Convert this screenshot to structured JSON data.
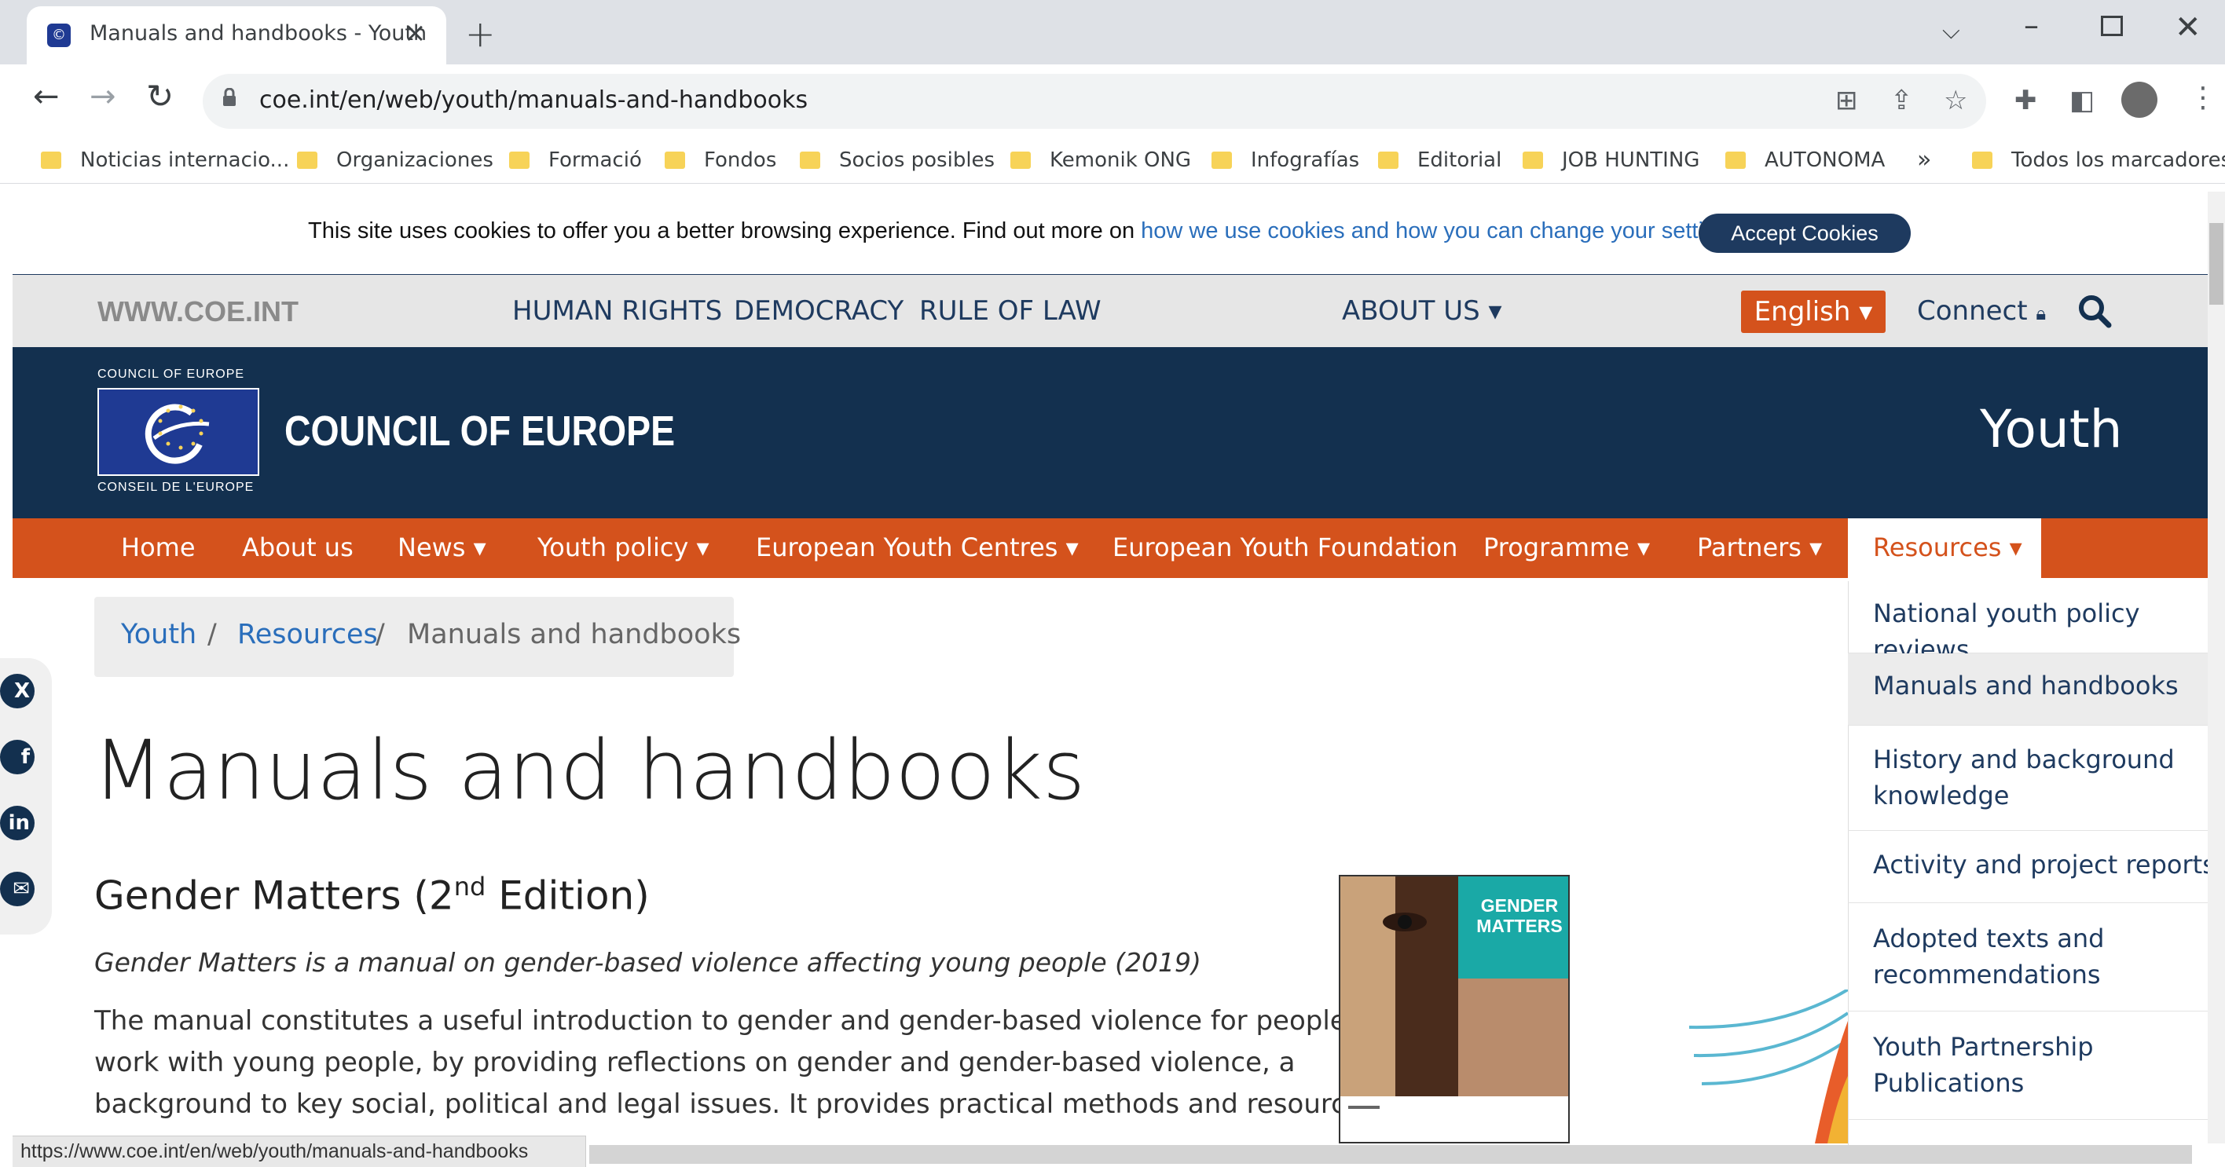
{
  "browser": {
    "tab_title": "Manuals and handbooks - Youth",
    "url": "coe.int/en/web/youth/manuals-and-handbooks",
    "status_url": "https://www.coe.int/en/web/youth/manuals-and-handbooks",
    "bookmarks": [
      "Noticias internacio...",
      "Organizaciones",
      "Formació",
      "Fondos",
      "Socios posibles",
      "Kemonik ONG",
      "Infografías",
      "Editorial",
      "JOB HUNTING",
      "AUTONOMA"
    ],
    "bookmarks_overflow": "»",
    "all_bookmarks": "Todos los marcadores"
  },
  "cookie": {
    "text": "This site uses cookies to offer you a better browsing experience. Find out more on ",
    "link": "how we use cookies and how you can change your settings",
    "after": ".",
    "accept": "Accept Cookies"
  },
  "top_nav": {
    "site": "WWW.COE.INT",
    "links": [
      "HUMAN RIGHTS",
      "DEMOCRACY",
      "RULE OF LAW"
    ],
    "about": "ABOUT US ▾",
    "language": "English ▾",
    "connect": "Connect"
  },
  "banner": {
    "logo_top": "COUNCIL OF EUROPE",
    "logo_bottom": "CONSEIL DE L'EUROPE",
    "org_name": "COUNCIL OF EUROPE",
    "section": "Youth"
  },
  "main_nav": {
    "items": [
      "Home",
      "About us",
      "News ▾",
      "Youth policy ▾",
      "European Youth Centres ▾",
      "European Youth Foundation",
      "Programme ▾",
      "Partners ▾"
    ],
    "active": "Resources ▾"
  },
  "breadcrumb": {
    "items": [
      "Youth",
      "Resources",
      "Manuals and handbooks"
    ],
    "sep": "/"
  },
  "article": {
    "page_title": "Manuals and handbooks",
    "title_a": "Gender Matters (2",
    "title_sup": "nd",
    "title_b": " Edition)",
    "subtitle": "Gender Matters is a manual on gender-based violence affecting young people (2019)",
    "lines": [
      "The manual constitutes a useful introduction to gender and gender-based violence for people who",
      "work with young people, by providing reflections on gender and gender-based violence, a",
      "background to key social, political and legal issues. It provides practical methods and resources for"
    ],
    "cover_title": "GENDER MATTERS"
  },
  "dropdown": [
    "National youth policy reviews",
    "Manuals and handbooks",
    "History and background knowledge",
    "Activity and project reports",
    "Adopted texts and recommendations",
    "Youth Partnership Publications"
  ],
  "colors": {
    "navy": "#13304f",
    "orange": "#d4521c",
    "link": "#2a6ebb"
  }
}
